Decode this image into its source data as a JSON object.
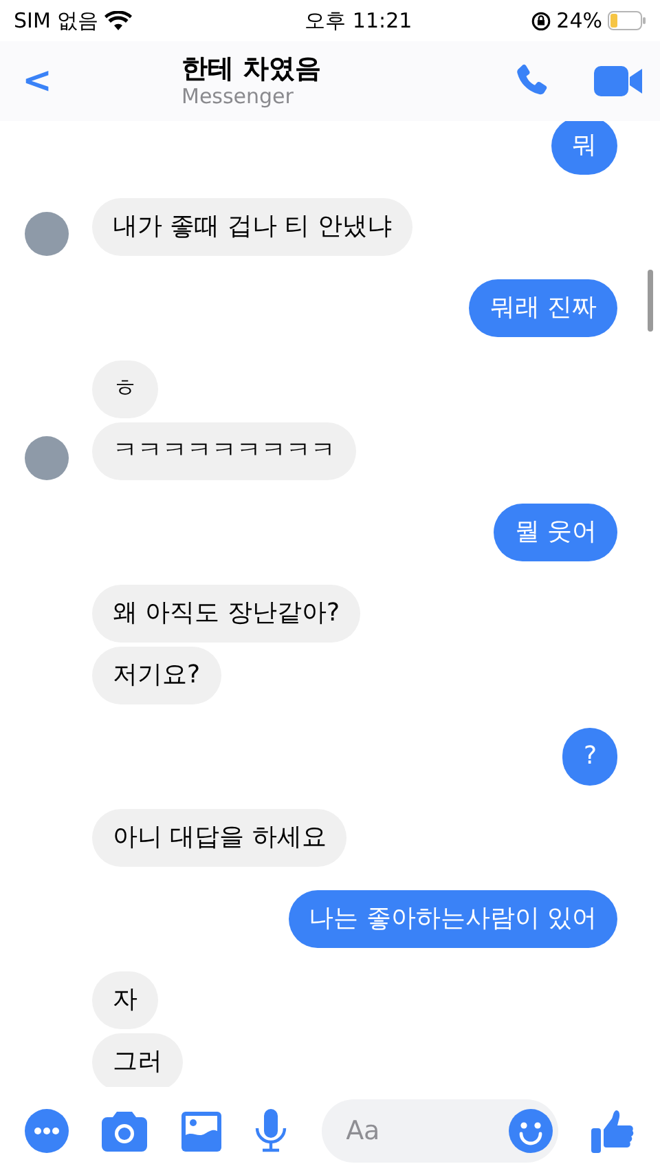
{
  "status_bar": {
    "carrier": "SIM 없음",
    "time": "오후 11:21",
    "battery": "24%"
  },
  "header": {
    "back": "<",
    "title": "한테 차였음",
    "subtitle": "Messenger"
  },
  "messages": [
    {
      "kind": "sent",
      "text": "뭐",
      "avatar": false
    },
    {
      "kind": "received",
      "text": "내가   좋때 겁나 티 안냈냐",
      "avatar": true
    },
    {
      "kind": "sent",
      "text": "뭐래 진짜",
      "avatar": false
    },
    {
      "kind": "received",
      "text": "ㅎ",
      "avatar": false
    },
    {
      "kind": "received",
      "text": "ㅋㅋㅋㅋㅋㅋㅋㅋㅋ",
      "avatar": true
    },
    {
      "kind": "sent",
      "text": "뭘 웃어",
      "avatar": false
    },
    {
      "kind": "received",
      "text": "왜 아직도 장난같아?",
      "avatar": false
    },
    {
      "kind": "received",
      "text": "저기요?",
      "avatar": false
    },
    {
      "kind": "sent",
      "text": "?",
      "avatar": false
    },
    {
      "kind": "received",
      "text": "아니 대답을 하세요",
      "avatar": false
    },
    {
      "kind": "sent",
      "text": "나는 좋아하는사람이 있어",
      "avatar": false
    },
    {
      "kind": "received",
      "text": "자",
      "avatar": false
    },
    {
      "kind": "received",
      "text": "그러",
      "avatar": false
    }
  ],
  "composer": {
    "placeholder": "Aa"
  }
}
